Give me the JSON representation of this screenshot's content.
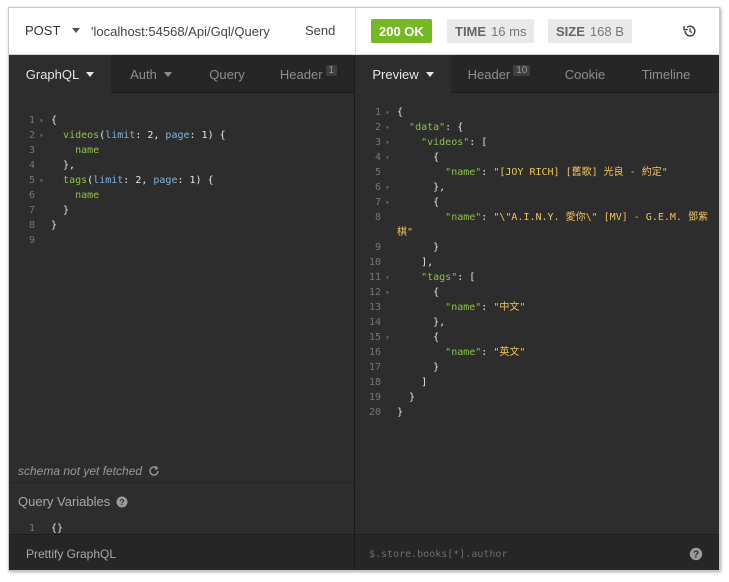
{
  "request": {
    "method": "POST",
    "url": "'localhost:54568/Api/Gql/Query",
    "send_label": "Send"
  },
  "response_meta": {
    "status": "200 OK",
    "time_label": "TIME",
    "time_value": "16 ms",
    "size_label": "SIZE",
    "size_value": "168 B"
  },
  "left_tabs": [
    {
      "label": "GraphQL",
      "active": true
    },
    {
      "label": "Auth",
      "active": false
    },
    {
      "label": "Query",
      "active": false
    },
    {
      "label": "Header",
      "count": "1",
      "active": false
    }
  ],
  "right_tabs": [
    {
      "label": "Preview",
      "active": true
    },
    {
      "label": "Header",
      "count": "10",
      "active": false
    },
    {
      "label": "Cookie",
      "active": false
    },
    {
      "label": "Timeline",
      "active": false
    }
  ],
  "query_lines": [
    {
      "n": "1",
      "fold": true,
      "tokens": [
        [
          "pn",
          "{"
        ]
      ]
    },
    {
      "n": "2",
      "fold": true,
      "tokens": [
        [
          "pn",
          "  "
        ],
        [
          "fn",
          "videos"
        ],
        [
          "pn",
          "("
        ],
        [
          "arg",
          "limit"
        ],
        [
          "pn",
          ": 2, "
        ],
        [
          "arg",
          "page"
        ],
        [
          "pn",
          ": 1) {"
        ]
      ]
    },
    {
      "n": "3",
      "fold": false,
      "tokens": [
        [
          "pn",
          "    "
        ],
        [
          "fn",
          "name"
        ]
      ]
    },
    {
      "n": "4",
      "fold": false,
      "tokens": [
        [
          "pn",
          "  },"
        ]
      ]
    },
    {
      "n": "5",
      "fold": true,
      "tokens": [
        [
          "pn",
          "  "
        ],
        [
          "fn",
          "tags"
        ],
        [
          "pn",
          "("
        ],
        [
          "arg",
          "limit"
        ],
        [
          "pn",
          ": 2, "
        ],
        [
          "arg",
          "page"
        ],
        [
          "pn",
          ": 1) {"
        ]
      ]
    },
    {
      "n": "6",
      "fold": false,
      "tokens": [
        [
          "pn",
          "    "
        ],
        [
          "fn",
          "name"
        ]
      ]
    },
    {
      "n": "7",
      "fold": false,
      "tokens": [
        [
          "pn",
          "  }"
        ]
      ]
    },
    {
      "n": "8",
      "fold": false,
      "tokens": [
        [
          "pn",
          "}"
        ]
      ]
    },
    {
      "n": "9",
      "fold": false,
      "tokens": []
    }
  ],
  "response_lines": [
    {
      "n": "1",
      "fold": true,
      "tokens": [
        [
          "pn",
          "{"
        ]
      ]
    },
    {
      "n": "2",
      "fold": true,
      "tokens": [
        [
          "pn",
          "  "
        ],
        [
          "key",
          "\"data\""
        ],
        [
          "pn",
          ": {"
        ]
      ]
    },
    {
      "n": "3",
      "fold": true,
      "tokens": [
        [
          "pn",
          "    "
        ],
        [
          "key",
          "\"videos\""
        ],
        [
          "pn",
          ": ["
        ]
      ]
    },
    {
      "n": "4",
      "fold": true,
      "tokens": [
        [
          "pn",
          "      {"
        ]
      ]
    },
    {
      "n": "5",
      "fold": false,
      "tokens": [
        [
          "pn",
          "        "
        ],
        [
          "key",
          "\"name\""
        ],
        [
          "pn",
          ": "
        ],
        [
          "str",
          "\"[JOY RICH] [舊歌] 光良 - 約定\""
        ]
      ]
    },
    {
      "n": "6",
      "fold": true,
      "tokens": [
        [
          "pn",
          "      },"
        ]
      ]
    },
    {
      "n": "7",
      "fold": true,
      "tokens": [
        [
          "pn",
          "      {"
        ]
      ]
    },
    {
      "n": "8",
      "fold": false,
      "tokens": [
        [
          "pn",
          "        "
        ],
        [
          "key",
          "\"name\""
        ],
        [
          "pn",
          ": "
        ],
        [
          "str",
          "\"\\\"A.I.N.Y. 愛你\\\" [MV] - G.E.M. 鄧紫棋\""
        ]
      ]
    },
    {
      "n": "9",
      "fold": false,
      "tokens": [
        [
          "pn",
          "      }"
        ]
      ]
    },
    {
      "n": "10",
      "fold": false,
      "tokens": [
        [
          "pn",
          "    ],"
        ]
      ]
    },
    {
      "n": "11",
      "fold": true,
      "tokens": [
        [
          "pn",
          "    "
        ],
        [
          "key",
          "\"tags\""
        ],
        [
          "pn",
          ": ["
        ]
      ]
    },
    {
      "n": "12",
      "fold": true,
      "tokens": [
        [
          "pn",
          "      {"
        ]
      ]
    },
    {
      "n": "13",
      "fold": false,
      "tokens": [
        [
          "pn",
          "        "
        ],
        [
          "key",
          "\"name\""
        ],
        [
          "pn",
          ": "
        ],
        [
          "str",
          "\"中文\""
        ]
      ]
    },
    {
      "n": "14",
      "fold": false,
      "tokens": [
        [
          "pn",
          "      },"
        ]
      ]
    },
    {
      "n": "15",
      "fold": true,
      "tokens": [
        [
          "pn",
          "      {"
        ]
      ]
    },
    {
      "n": "16",
      "fold": false,
      "tokens": [
        [
          "pn",
          "        "
        ],
        [
          "key",
          "\"name\""
        ],
        [
          "pn",
          ": "
        ],
        [
          "str",
          "\"英文\""
        ]
      ]
    },
    {
      "n": "17",
      "fold": false,
      "tokens": [
        [
          "pn",
          "      }"
        ]
      ]
    },
    {
      "n": "18",
      "fold": false,
      "tokens": [
        [
          "pn",
          "    ]"
        ]
      ]
    },
    {
      "n": "19",
      "fold": false,
      "tokens": [
        [
          "pn",
          "  }"
        ]
      ]
    },
    {
      "n": "20",
      "fold": false,
      "tokens": [
        [
          "pn",
          "}"
        ]
      ]
    }
  ],
  "schema_status": "schema not yet fetched",
  "query_variables": {
    "title": "Query Variables",
    "line_no": "1",
    "value": "{}"
  },
  "prettify_label": "Prettify GraphQL",
  "filter_placeholder": "$.store.books[*].author",
  "icons": {
    "method_caret": "chevron-down-icon",
    "history": "history-icon",
    "refresh": "refresh-icon",
    "help": "help-circle-icon"
  },
  "colors": {
    "status_ok": "#75ba24",
    "json_key": "#8bc34a",
    "json_string": "#f0c35a",
    "graphql_arg": "#7fb3e0",
    "panel_bg": "#2d2d2d"
  }
}
